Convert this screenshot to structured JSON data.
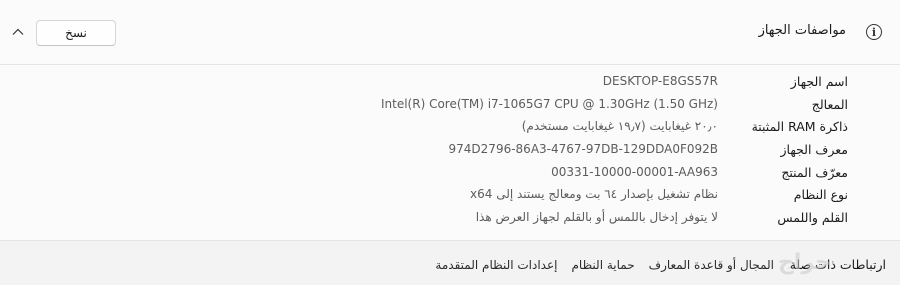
{
  "section": {
    "title": "مواصفات الجهاز",
    "copy_label": "نسخ"
  },
  "specs": [
    {
      "label": "اسم الجهاز",
      "value": "DESKTOP-E8GS57R"
    },
    {
      "label": "المعالج",
      "value": "Intel(R) Core(TM) i7-1065G7 CPU @ 1.30GHz (1.50 GHz)"
    },
    {
      "label": "ذاكرة RAM المثبتة",
      "value": "٢٠٫٠ غيغابايت (١٩٫٧ غيغابايت مستخدم)"
    },
    {
      "label": "معرف الجهاز",
      "value": "974D2796-86A3-4767-97DB-129DDA0F092B"
    },
    {
      "label": "معرّف المنتج",
      "value": "00331-10000-00001-AA963"
    },
    {
      "label": "نوع النظام",
      "value": "نظام تشغيل بإصدار ٦٤ بت ومعالج يستند إلى x64"
    },
    {
      "label": "القلم واللمس",
      "value": "لا يتوفر إدخال باللمس أو بالقلم لجهاز العرض هذا"
    }
  ],
  "footer": {
    "title": "ارتباطات ذات صلة",
    "links": [
      "المجال أو قاعدة المعارف",
      "حماية النظام",
      "إعدادات النظام المتقدمة"
    ]
  },
  "watermark": "حراج"
}
